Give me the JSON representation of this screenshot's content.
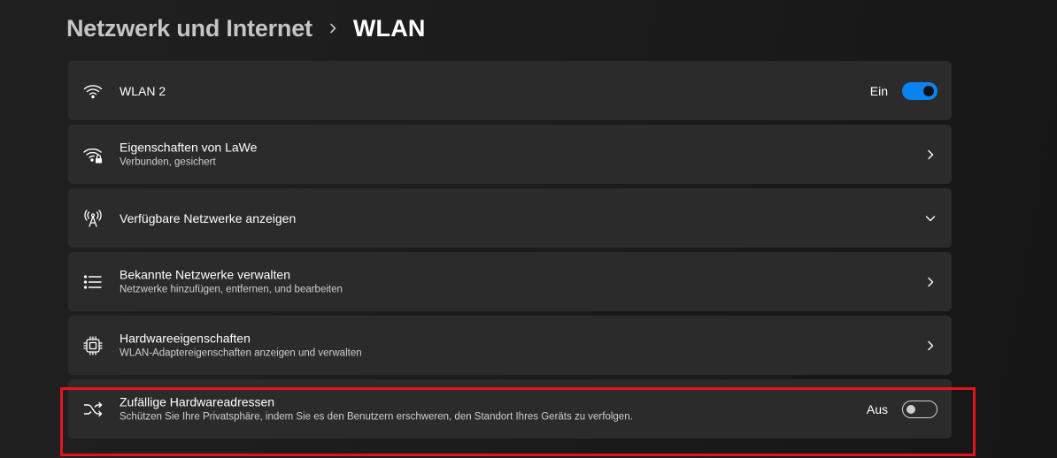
{
  "breadcrumb": {
    "parent": "Netzwerk und Internet",
    "separator_icon": "chevron-right-icon",
    "current": "WLAN"
  },
  "cards": [
    {
      "icon": "wifi-icon",
      "title": "WLAN 2",
      "subtitle": "",
      "control": "toggle",
      "toggle_label": "Ein",
      "toggle_state": true
    },
    {
      "icon": "wifi-lock-icon",
      "title": "Eigenschaften von LaWe",
      "subtitle": "Verbunden, gesichert",
      "control": "chevron-right-icon"
    },
    {
      "icon": "antenna-icon",
      "title": "Verfügbare Netzwerke anzeigen",
      "subtitle": "",
      "control": "chevron-down-icon"
    },
    {
      "icon": "list-icon",
      "title": "Bekannte Netzwerke verwalten",
      "subtitle": "Netzwerke hinzufügen, entfernen, und bearbeiten",
      "control": "chevron-right-icon"
    },
    {
      "icon": "chip-icon",
      "title": "Hardwareeigenschaften",
      "subtitle": "WLAN-Adaptereigenschaften anzeigen und verwalten",
      "control": "chevron-right-icon"
    },
    {
      "icon": "shuffle-icon",
      "title": "Zufällige Hardwareadressen",
      "subtitle": "Schützen Sie Ihre Privatsphäre, indem Sie es den Benutzern erschweren, den Standort Ihres Geräts zu verfolgen.",
      "control": "toggle",
      "toggle_label": "Aus",
      "toggle_state": false
    }
  ],
  "colors": {
    "accent": "#0a84f0",
    "card_bg": "#2b2b2b",
    "highlight": "#e3141b"
  }
}
